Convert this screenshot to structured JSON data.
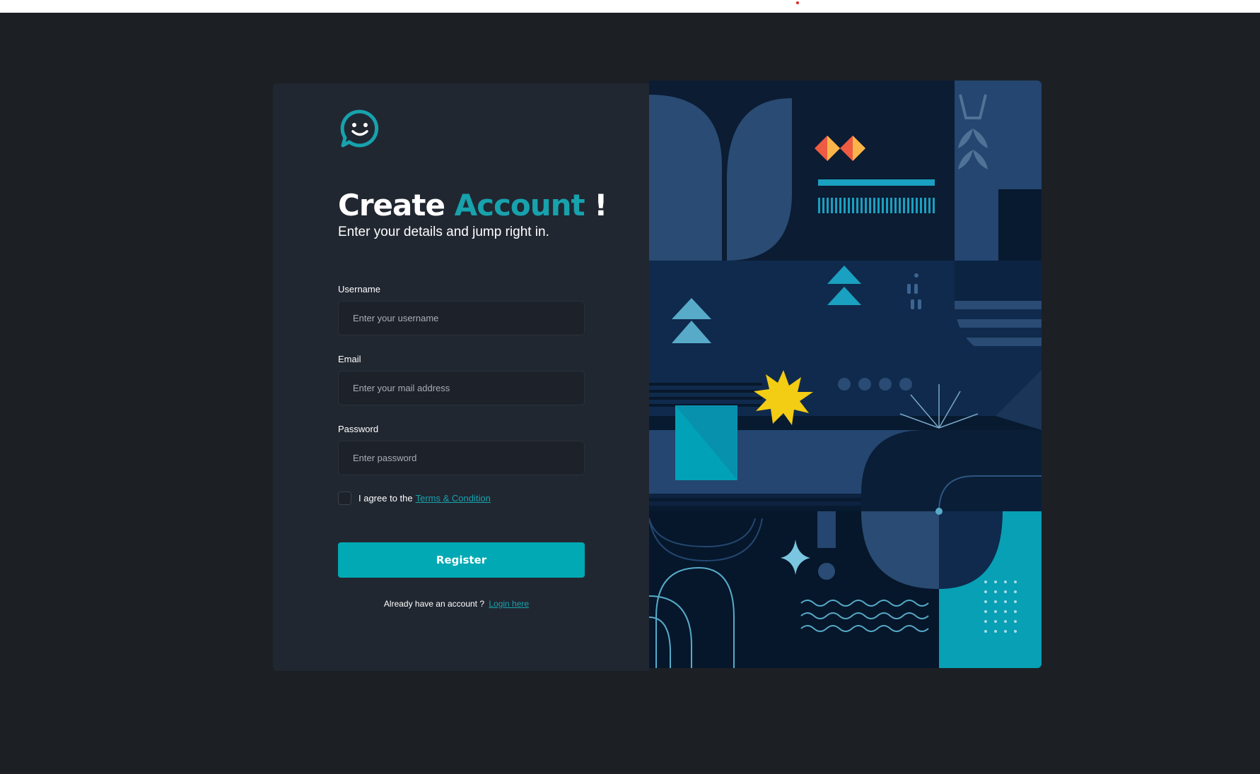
{
  "form": {
    "title_main": "Create",
    "title_accent": "Account",
    "title_end": "!",
    "subtitle": "Enter your details and jump right in.",
    "username_label": "Username",
    "username_placeholder": "Enter your username",
    "email_label": "Email",
    "email_placeholder": "Enter your mail address",
    "password_label": "Password",
    "password_placeholder": "Enter password",
    "agree_text": "I agree to the",
    "terms_link": "Terms & Condition",
    "register_label": "Register",
    "have_account_text": "Already have an account ?",
    "login_link": "Login here"
  },
  "icons": {
    "logo": "smiley-chat-bubble-icon"
  },
  "colors": {
    "background": "#1c2025",
    "panel": "#212731",
    "accent": "#00a9b3",
    "art_background": "#071a30"
  }
}
